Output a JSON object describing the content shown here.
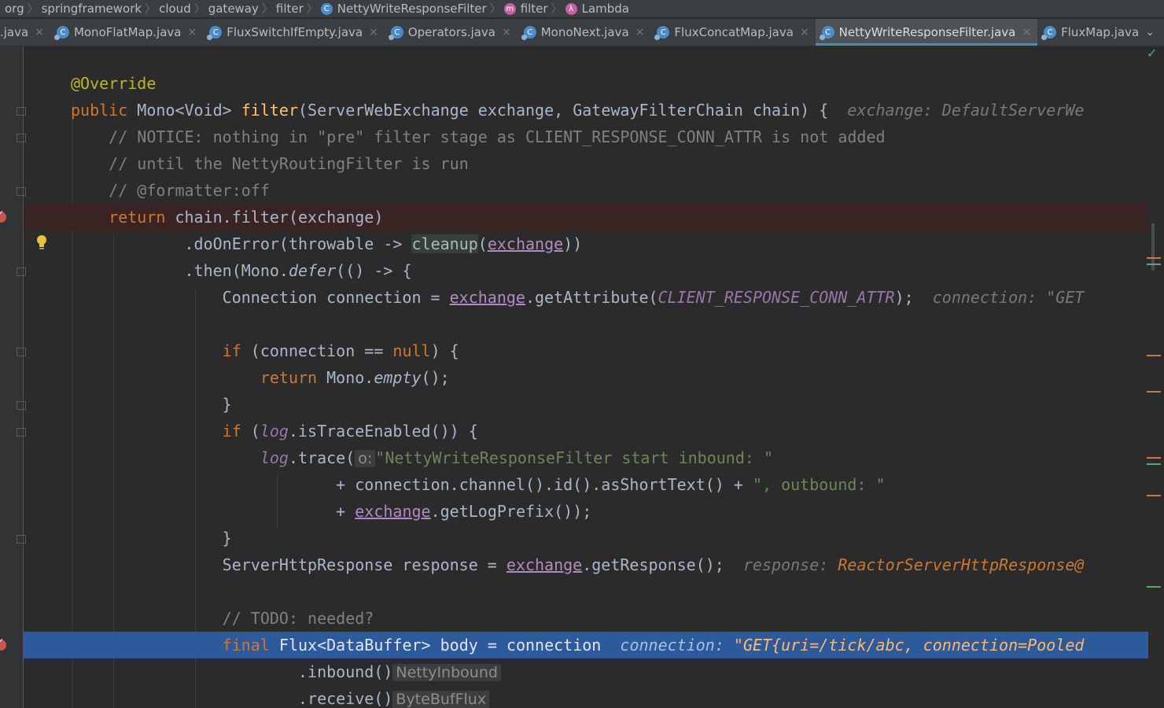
{
  "breadcrumb": {
    "items": [
      "org",
      "springframework",
      "cloud",
      "gateway",
      "filter",
      "NettyWriteResponseFilter",
      "filter",
      "Lambda"
    ]
  },
  "tabs": [
    {
      "label": ".java",
      "active": false
    },
    {
      "label": "MonoFlatMap.java",
      "active": false
    },
    {
      "label": "FluxSwitchIfEmpty.java",
      "active": false
    },
    {
      "label": "Operators.java",
      "active": false
    },
    {
      "label": "MonoNext.java",
      "active": false
    },
    {
      "label": "FluxConcatMap.java",
      "active": false
    },
    {
      "label": "NettyWriteResponseFilter.java",
      "active": true
    },
    {
      "label": "FluxMap.java",
      "active": false
    }
  ],
  "icons": {
    "class_icon": "C",
    "method_icon": "m",
    "lambda_icon": "λ",
    "close_icon": "×",
    "overflow_icon": "⌄",
    "check_icon": "✓"
  },
  "code": {
    "l1": "@Override",
    "l2_kw": "public",
    "l2_a": " Mono<Void> ",
    "l2_fn": "filter",
    "l2_b": "(ServerWebExchange exchange, GatewayFilterChain chain) {",
    "l2_hint": "exchange: DefaultServerWe",
    "l3": "// NOTICE: nothing in \"pre\" filter stage as CLIENT_RESPONSE_CONN_ATTR is not added",
    "l4": "// until the NettyRoutingFilter is run",
    "l5": "// @formatter:off",
    "l6_kw": "return",
    "l6_rest": " chain.filter(exchange)",
    "l7_a": ".doOnError(throwable -> ",
    "l7_fn": "cleanup",
    "l7_b": "(",
    "l7_p": "exchange",
    "l7_c": "))",
    "l8_a": ".then(Mono.",
    "l8_it": "defer",
    "l8_b": "(() -> {",
    "l9_a": "Connection connection = ",
    "l9_p": "exchange",
    "l9_b": ".getAttribute(",
    "l9_const": "CLIENT_RESPONSE_CONN_ATTR",
    "l9_c": ");",
    "l9_hint": "connection: \"GET",
    "l11_kw": "if",
    "l11_a": " (connection == ",
    "l11_kw2": "null",
    "l11_b": ") {",
    "l12_kw": "return",
    "l12_a": " Mono.",
    "l12_it": "empty",
    "l12_b": "();",
    "l13": "}",
    "l14_kw": "if",
    "l14_a": " (",
    "l14_it": "log",
    "l14_b": ".isTraceEnabled()) {",
    "l15_it": "log",
    "l15_a": ".trace(",
    "l15_hint": "o:",
    "l15_str": "\"NettyWriteResponseFilter start inbound: \"",
    "l16_a": "+ connection.channel().id().asShortText() + ",
    "l16_str": "\", outbound: \"",
    "l17_a": "+ ",
    "l17_p": "exchange",
    "l17_b": ".getLogPrefix());",
    "l18": "}",
    "l19_a": "ServerHttpResponse response = ",
    "l19_p": "exchange",
    "l19_b": ".getResponse();",
    "l19_hint": "response:",
    "l19_hintval": "ReactorServerHttpResponse@",
    "l21": "// TODO: needed?",
    "l22_kw": "final",
    "l22_a": " Flux<DataBuffer> body = connection",
    "l22_hint": "connection:",
    "l22_hintval": "\"GET{uri=/tick/abc, connection=Pooled",
    "l23_a": ".inbound()",
    "l23_hint": "NettyInbound",
    "l24_a": ".receive()",
    "l24_hint": "ByteBufFlux"
  },
  "colors": {
    "background": "#2b2b2b",
    "keyword": "#cc7832",
    "annotation": "#bbb529",
    "comment": "#808080",
    "string": "#6a8759",
    "function": "#ffc66d",
    "constant": "#9876aa",
    "execution_line": "#2d5a9b",
    "breakpoint_line": "#3a2323",
    "breakpoint": "#c75450"
  }
}
